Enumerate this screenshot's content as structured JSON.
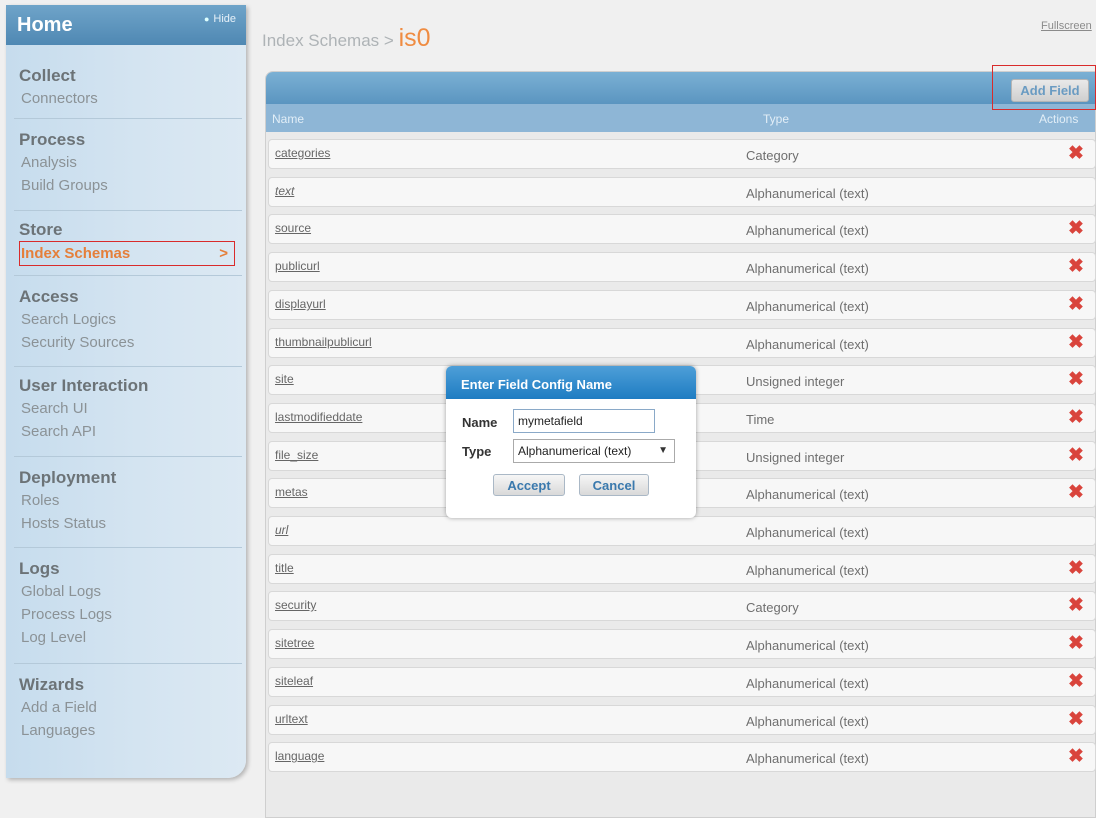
{
  "sidebar": {
    "home": "Home",
    "hide": "Hide",
    "sections": [
      {
        "title": "Collect",
        "items": [
          "Connectors"
        ]
      },
      {
        "title": "Process",
        "items": [
          "Analysis",
          "Build Groups"
        ]
      },
      {
        "title": "Store",
        "items": [
          "Index Schemas"
        ]
      },
      {
        "title": "Access",
        "items": [
          "Search Logics",
          "Security Sources"
        ]
      },
      {
        "title": "User Interaction",
        "items": [
          "Search UI",
          "Search API"
        ]
      },
      {
        "title": "Deployment",
        "items": [
          "Roles",
          "Hosts Status"
        ]
      },
      {
        "title": "Logs",
        "items": [
          "Global Logs",
          "Process Logs",
          "Log Level"
        ]
      },
      {
        "title": "Wizards",
        "items": [
          "Add a Field",
          "Languages"
        ]
      }
    ]
  },
  "breadcrumb": {
    "parent": "Index Schemas",
    "separator": ">",
    "current": "is0"
  },
  "fullscreen": "Fullscreen",
  "panel": {
    "add_field": "Add Field",
    "columns": {
      "name": "Name",
      "type": "Type",
      "actions": "Actions"
    }
  },
  "fields": [
    {
      "name": "categories",
      "type": "Category",
      "deletable": true
    },
    {
      "name": "text",
      "type": "Alphanumerical (text)",
      "deletable": false
    },
    {
      "name": "source",
      "type": "Alphanumerical (text)",
      "deletable": true
    },
    {
      "name": "publicurl",
      "type": "Alphanumerical (text)",
      "deletable": true
    },
    {
      "name": "displayurl",
      "type": "Alphanumerical (text)",
      "deletable": true
    },
    {
      "name": "thumbnailpublicurl",
      "type": "Alphanumerical (text)",
      "deletable": true
    },
    {
      "name": "site",
      "type": "Unsigned integer",
      "deletable": true
    },
    {
      "name": "lastmodifieddate",
      "type": "Time",
      "deletable": true
    },
    {
      "name": "file_size",
      "type": "Unsigned integer",
      "deletable": true
    },
    {
      "name": "metas",
      "type": "Alphanumerical (text)",
      "deletable": true
    },
    {
      "name": "url",
      "type": "Alphanumerical (text)",
      "deletable": false
    },
    {
      "name": "title",
      "type": "Alphanumerical (text)",
      "deletable": true
    },
    {
      "name": "security",
      "type": "Category",
      "deletable": true
    },
    {
      "name": "sitetree",
      "type": "Alphanumerical (text)",
      "deletable": true
    },
    {
      "name": "siteleaf",
      "type": "Alphanumerical (text)",
      "deletable": true
    },
    {
      "name": "urltext",
      "type": "Alphanumerical (text)",
      "deletable": true
    },
    {
      "name": "language",
      "type": "Alphanumerical (text)",
      "deletable": true
    }
  ],
  "dialog": {
    "title": "Enter Field Config Name",
    "name_label": "Name",
    "name_value": "mymetafield",
    "type_label": "Type",
    "type_value": "Alphanumerical (text)",
    "accept": "Accept",
    "cancel": "Cancel"
  },
  "colors": {
    "accent": "#e57f3a",
    "header_blue": "#5b95c0",
    "delete_red": "#d9443c",
    "highlight_red": "#d92b2b"
  },
  "icons": {
    "delete": "delete-x-icon",
    "hide": "pin-icon",
    "arrow": "chevron-right-icon",
    "caret": "caret-down-icon"
  }
}
